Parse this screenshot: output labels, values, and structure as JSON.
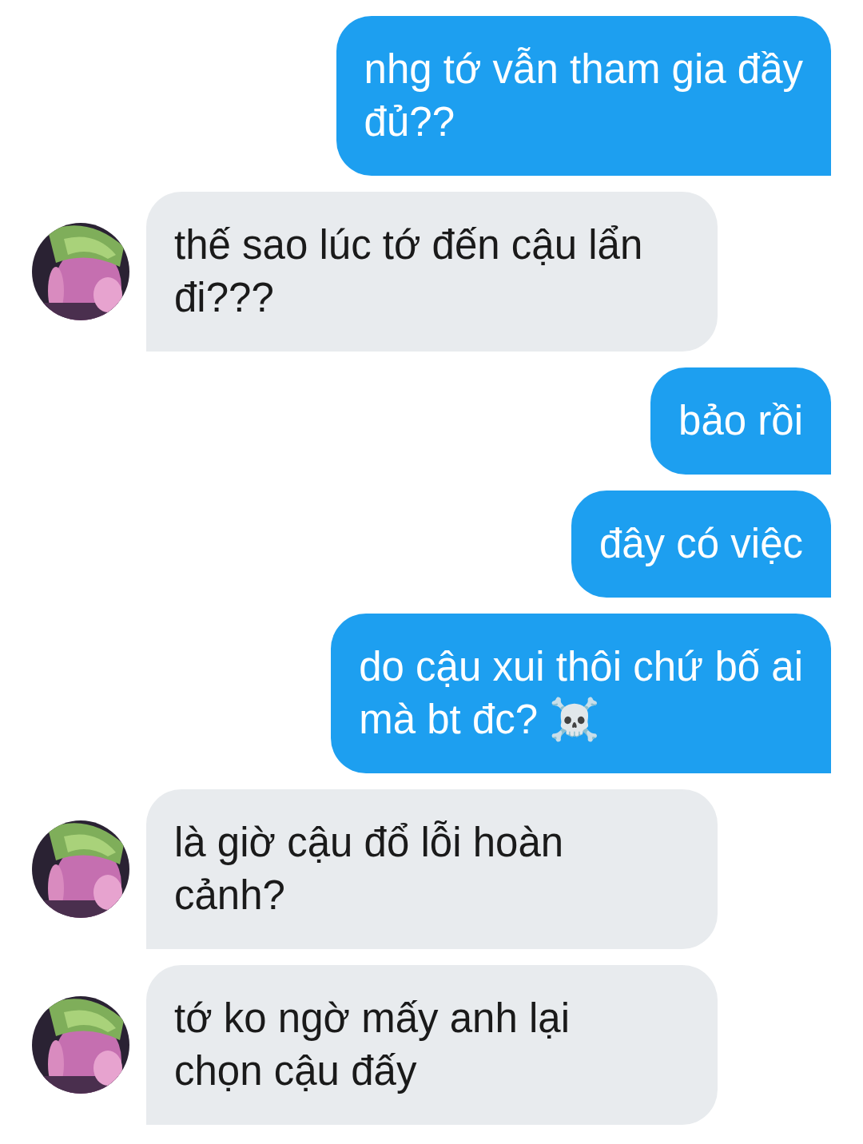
{
  "messages": [
    {
      "kind": "outgoing",
      "text": "nhg tớ vẫn tham gia đầy\nđủ??"
    },
    {
      "kind": "incoming",
      "text": "thế sao lúc tớ đến cậu lẩn\nđi???"
    },
    {
      "kind": "outgoing",
      "text": "bảo rồi"
    },
    {
      "kind": "outgoing",
      "text": "đây có việc"
    },
    {
      "kind": "outgoing",
      "text": "do cậu xui thôi chứ bố ai\nmà bt đc? ☠️"
    },
    {
      "kind": "incoming",
      "text": "là giờ cậu đổ lỗi hoàn\ncảnh?"
    },
    {
      "kind": "incoming",
      "text": "tớ ko ngờ mấy anh lại\nchọn cậu đấy"
    }
  ]
}
